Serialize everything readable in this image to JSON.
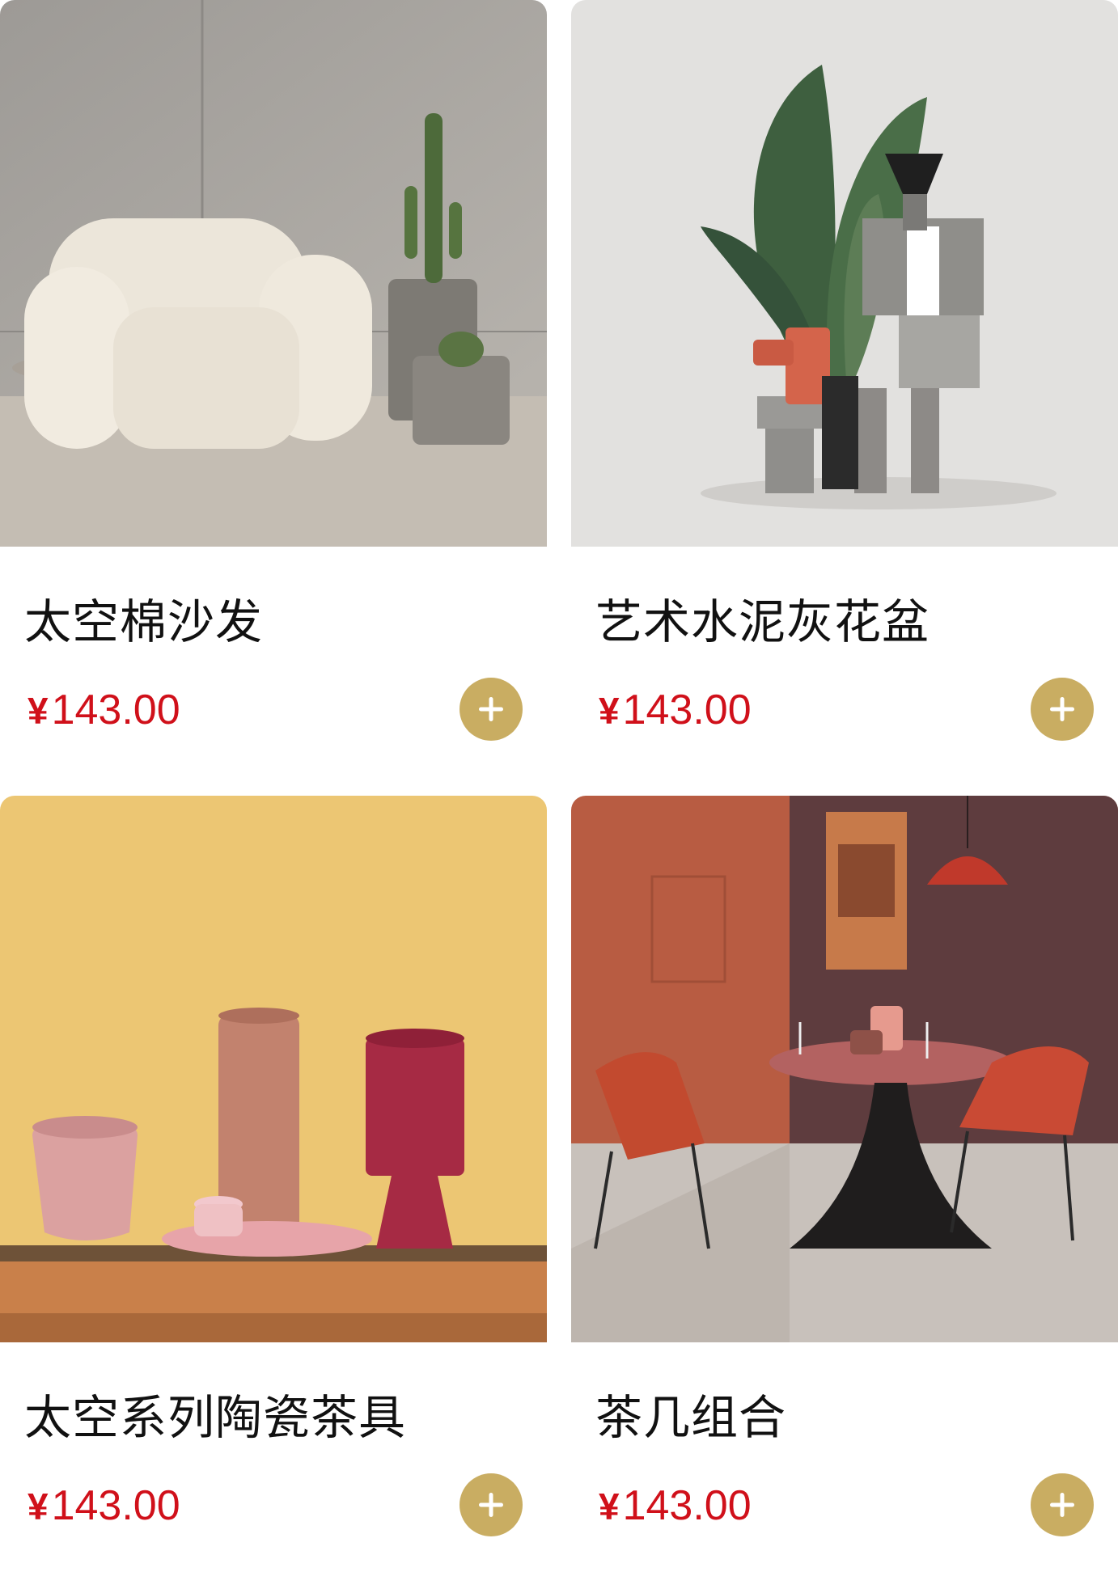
{
  "currency_symbol": "¥",
  "products": [
    {
      "name": "太空棉沙发",
      "price": "143.00",
      "add_icon": "plus-icon"
    },
    {
      "name": "艺术水泥灰花盆",
      "price": "143.00",
      "add_icon": "plus-icon"
    },
    {
      "name": "太空系列陶瓷茶具",
      "price": "143.00",
      "add_icon": "plus-icon"
    },
    {
      "name": "茶几组合",
      "price": "143.00",
      "add_icon": "plus-icon"
    }
  ],
  "colors": {
    "price": "#d0101a",
    "add_button": "#c9ad62",
    "title": "#111111"
  }
}
